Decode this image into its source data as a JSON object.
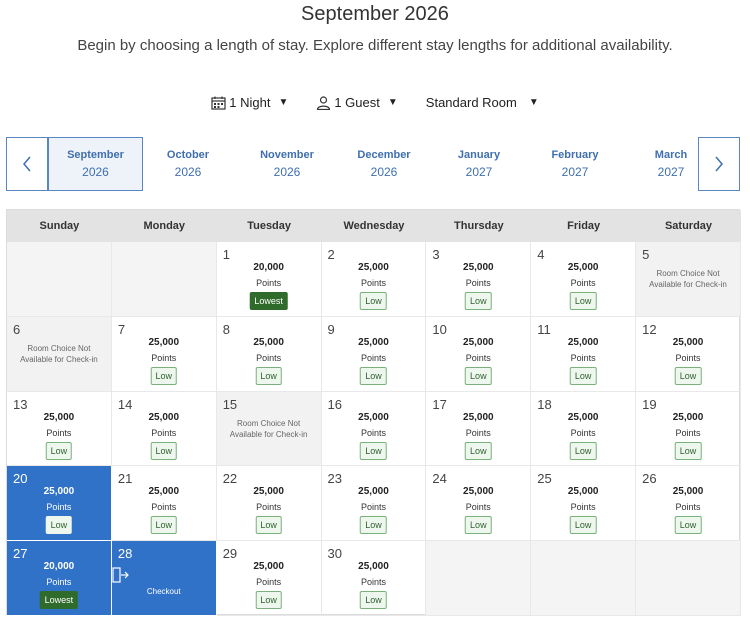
{
  "header": {
    "title": "September 2026",
    "subtitle": "Begin by choosing a length of stay. Explore different stay lengths for additional availability."
  },
  "filters": {
    "nights": "1 Night",
    "guests": "1 Guest",
    "room": "Standard Room"
  },
  "months": [
    {
      "name": "September",
      "year": "2026",
      "selected": true
    },
    {
      "name": "October",
      "year": "2026",
      "selected": false
    },
    {
      "name": "November",
      "year": "2026",
      "selected": false
    },
    {
      "name": "December",
      "year": "2026",
      "selected": false
    },
    {
      "name": "January",
      "year": "2027",
      "selected": false
    },
    {
      "name": "February",
      "year": "2027",
      "selected": false
    },
    {
      "name": "March",
      "year": "2027",
      "selected": false
    }
  ],
  "weekdays": [
    "Sunday",
    "Monday",
    "Tuesday",
    "Wednesday",
    "Thursday",
    "Friday",
    "Saturday"
  ],
  "labels": {
    "points": "Points",
    "not_available": "Room Choice Not Available for Check-in",
    "checkout": "Checkout"
  },
  "first_weekday": 2,
  "days": [
    {
      "day": 1,
      "points": "20,000",
      "badge": "Lowest",
      "state": "available"
    },
    {
      "day": 2,
      "points": "25,000",
      "badge": "Low",
      "state": "available"
    },
    {
      "day": 3,
      "points": "25,000",
      "badge": "Low",
      "state": "available"
    },
    {
      "day": 4,
      "points": "25,000",
      "badge": "Low",
      "state": "available"
    },
    {
      "day": 5,
      "points": "",
      "badge": "",
      "state": "unavailable"
    },
    {
      "day": 6,
      "points": "",
      "badge": "",
      "state": "unavailable"
    },
    {
      "day": 7,
      "points": "25,000",
      "badge": "Low",
      "state": "available"
    },
    {
      "day": 8,
      "points": "25,000",
      "badge": "Low",
      "state": "available"
    },
    {
      "day": 9,
      "points": "25,000",
      "badge": "Low",
      "state": "available"
    },
    {
      "day": 10,
      "points": "25,000",
      "badge": "Low",
      "state": "available"
    },
    {
      "day": 11,
      "points": "25,000",
      "badge": "Low",
      "state": "available"
    },
    {
      "day": 12,
      "points": "25,000",
      "badge": "Low",
      "state": "available"
    },
    {
      "day": 13,
      "points": "25,000",
      "badge": "Low",
      "state": "available"
    },
    {
      "day": 14,
      "points": "25,000",
      "badge": "Low",
      "state": "available"
    },
    {
      "day": 15,
      "points": "",
      "badge": "",
      "state": "unavailable"
    },
    {
      "day": 16,
      "points": "25,000",
      "badge": "Low",
      "state": "available"
    },
    {
      "day": 17,
      "points": "25,000",
      "badge": "Low",
      "state": "available"
    },
    {
      "day": 18,
      "points": "25,000",
      "badge": "Low",
      "state": "available"
    },
    {
      "day": 19,
      "points": "25,000",
      "badge": "Low",
      "state": "available"
    },
    {
      "day": 20,
      "points": "25,000",
      "badge": "Low",
      "state": "selected"
    },
    {
      "day": 21,
      "points": "25,000",
      "badge": "Low",
      "state": "available"
    },
    {
      "day": 22,
      "points": "25,000",
      "badge": "Low",
      "state": "available"
    },
    {
      "day": 23,
      "points": "25,000",
      "badge": "Low",
      "state": "available"
    },
    {
      "day": 24,
      "points": "25,000",
      "badge": "Low",
      "state": "available"
    },
    {
      "day": 25,
      "points": "25,000",
      "badge": "Low",
      "state": "available"
    },
    {
      "day": 26,
      "points": "25,000",
      "badge": "Low",
      "state": "available"
    },
    {
      "day": 27,
      "points": "20,000",
      "badge": "Lowest",
      "state": "selected"
    },
    {
      "day": 28,
      "points": "",
      "badge": "",
      "state": "checkout"
    },
    {
      "day": 29,
      "points": "25,000",
      "badge": "Low",
      "state": "available"
    },
    {
      "day": 30,
      "points": "25,000",
      "badge": "Low",
      "state": "available"
    }
  ],
  "colors": {
    "accent": "#3072c8",
    "link": "#3f6fb0",
    "lowest_badge": "#2f6b2a",
    "low_badge_bg": "#eef7ee"
  },
  "icons": {
    "nights": "calendar-icon",
    "guests": "person-icon",
    "prev": "chevron-left-icon",
    "next": "chevron-right-icon",
    "checkout": "door-exit-icon"
  }
}
